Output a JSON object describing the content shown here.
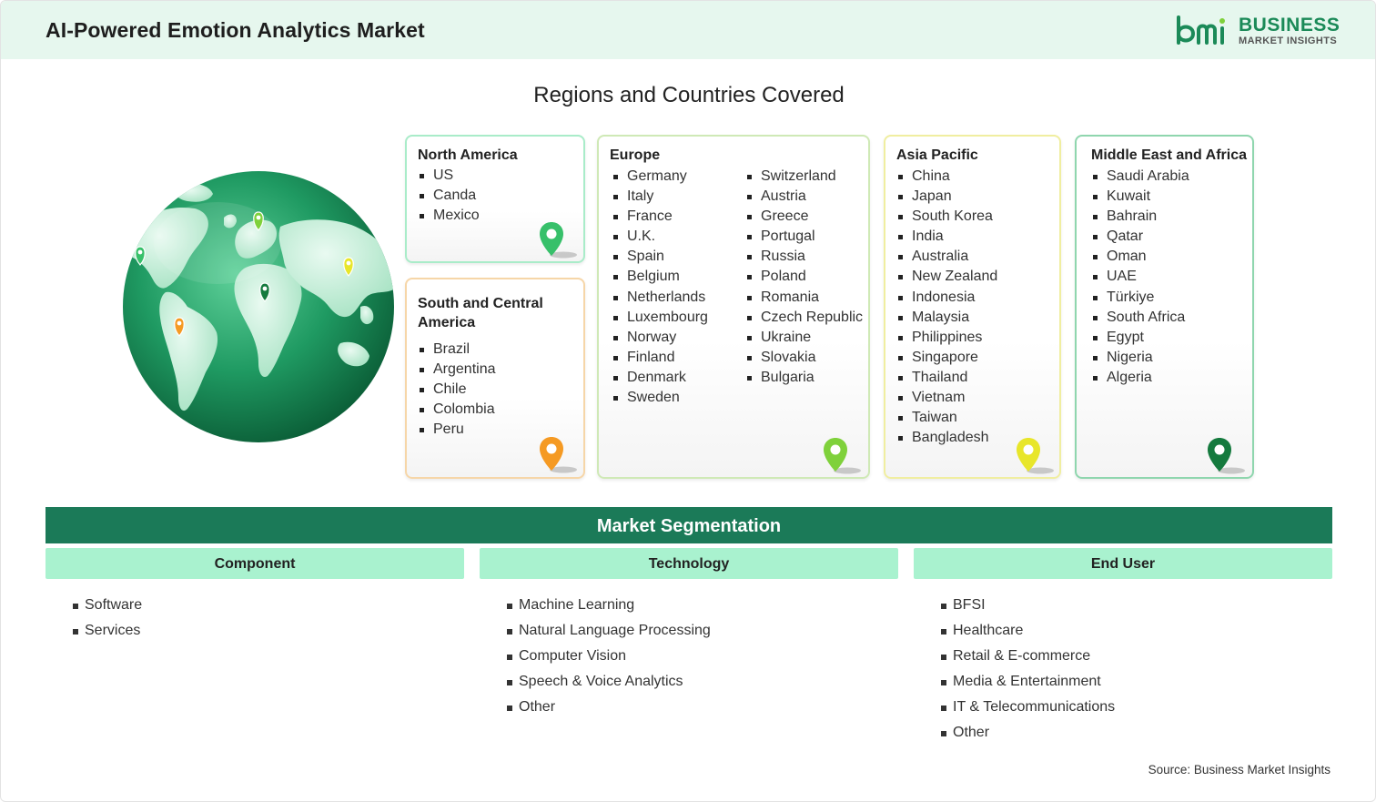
{
  "header": {
    "title": "AI-Powered Emotion Analytics Market",
    "logo_line1": "BUSINESS",
    "logo_line2": "MARKET INSIGHTS"
  },
  "regions": {
    "title": "Regions and Countries Covered",
    "north_america": {
      "title": "North America",
      "items": [
        "US",
        "Canda",
        "Mexico"
      ],
      "color": "#37c06a"
    },
    "south_america": {
      "title": "South and Central America",
      "items": [
        "Brazil",
        "Argentina",
        "Chile",
        "Colombia",
        "Peru"
      ],
      "color": "#f59a23"
    },
    "europe": {
      "title": "Europe",
      "items_col1": [
        "Germany",
        "Italy",
        "France",
        "U.K.",
        "Spain",
        "Belgium",
        "Netherlands",
        "Luxembourg",
        "Norway",
        "Finland",
        "Denmark",
        "Sweden"
      ],
      "items_col2": [
        "Switzerland",
        "Austria",
        "Greece",
        "Portugal",
        "Russia",
        "Poland",
        "Romania",
        "Czech Republic",
        "Ukraine",
        "Slovakia",
        "Bulgaria"
      ],
      "color": "#7fd13b"
    },
    "asia_pacific": {
      "title": "Asia Pacific",
      "items": [
        "China",
        "Japan",
        "South Korea",
        "India",
        "Australia",
        "New Zealand",
        "Indonesia",
        "Malaysia",
        "Philippines",
        "Singapore",
        "Thailand",
        "Vietnam",
        "Taiwan",
        "Bangladesh"
      ],
      "color": "#e8e62a"
    },
    "middle_east_africa": {
      "title": "Middle East and Africa",
      "items": [
        "Saudi Arabia",
        "Kuwait",
        "Bahrain",
        "Qatar",
        "Oman",
        "UAE",
        "Türkiye",
        "South Africa",
        "Egypt",
        "Nigeria",
        "Algeria"
      ],
      "color": "#157a3e"
    }
  },
  "segmentation": {
    "title": "Market Segmentation",
    "component": {
      "title": "Component",
      "items": [
        "Software",
        "Services"
      ]
    },
    "technology": {
      "title": "Technology",
      "items": [
        "Machine Learning",
        "Natural Language Processing",
        "Computer Vision",
        "Speech & Voice Analytics",
        "Other"
      ]
    },
    "end_user": {
      "title": "End User",
      "items": [
        "BFSI",
        "Healthcare",
        "Retail & E-commerce",
        "Media & Entertainment",
        "IT & Telecommunications",
        "Other"
      ]
    }
  },
  "source": "Source: Business Market Insights"
}
